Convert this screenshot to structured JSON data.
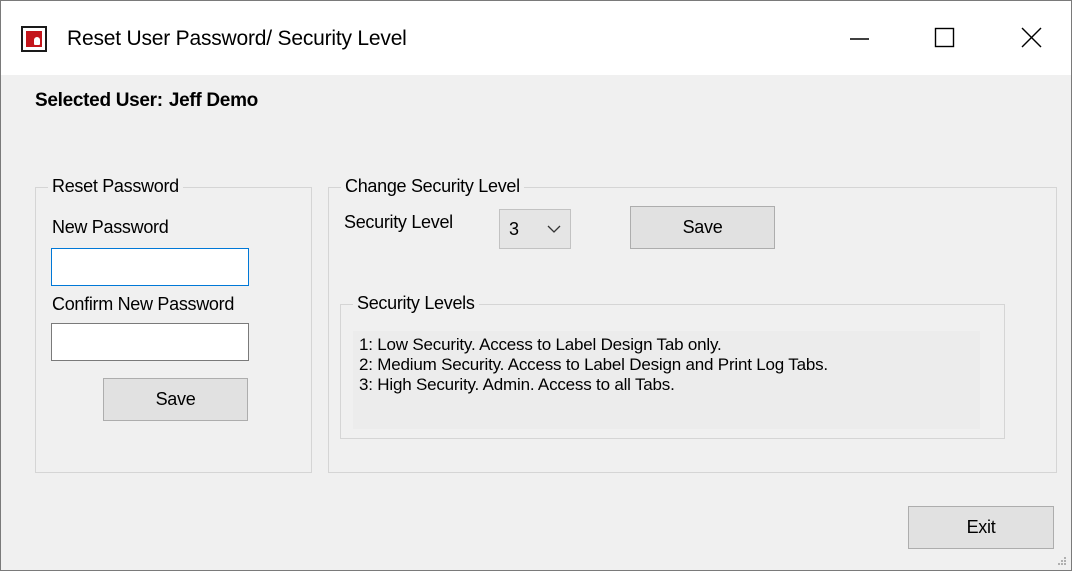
{
  "window": {
    "title": "Reset User Password/ Security Level"
  },
  "selected_user": {
    "label": "Selected User:",
    "name": "Jeff Demo"
  },
  "reset_password": {
    "group_title": "Reset Password",
    "new_password_label": "New Password",
    "new_password_value": "",
    "confirm_label": "Confirm New Password",
    "confirm_value": "",
    "save_label": "Save"
  },
  "security": {
    "group_title": "Change Security Level",
    "level_label": "Security Level",
    "level_value": "3",
    "save_label": "Save",
    "levels_group_title": "Security Levels",
    "levels": [
      "1: Low Security.  Access to Label Design Tab only.",
      "2: Medium Security.  Access to Label Design and Print Log Tabs.",
      "3: High Security.  Admin.  Access to all Tabs."
    ]
  },
  "footer": {
    "exit_label": "Exit"
  },
  "icons": {
    "app": "app-icon",
    "minimize": "minimize-icon",
    "maximize": "maximize-icon",
    "close": "close-icon",
    "dropdown": "chevron-down-icon",
    "resize": "resize-grip-icon"
  },
  "colors": {
    "focus_border": "#0078d7",
    "window_bg": "#f0f0f0",
    "button_bg": "#e1e1e1",
    "icon_red": "#c4161c"
  }
}
